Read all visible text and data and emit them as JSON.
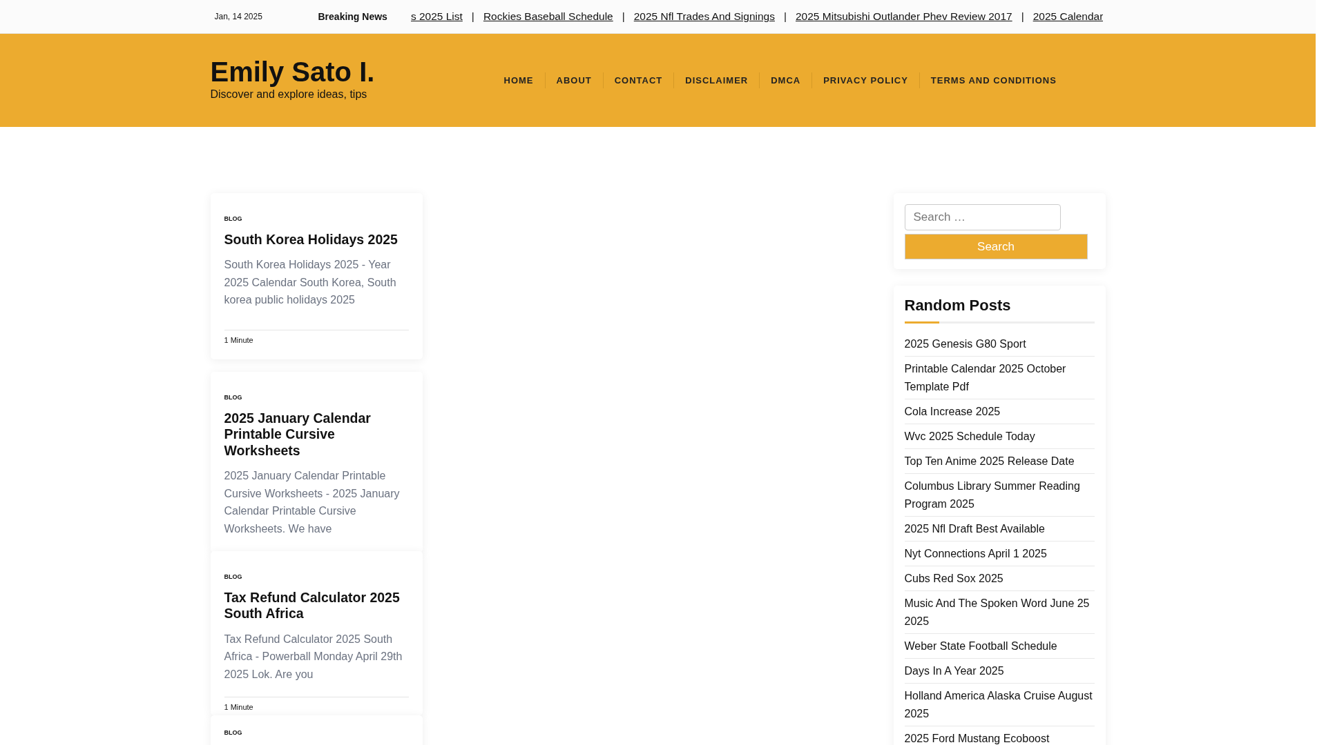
{
  "topbar": {
    "date": "Jan, 14 2025",
    "breaking_label": "Breaking News",
    "separator": "|",
    "ticker": [
      "s 2025 List",
      "Rockies Baseball Schedule",
      "2025 Nfl Trades And Signings",
      "2025 Mitsubishi Outlander Phev Review 2017",
      "2025 Calendar"
    ]
  },
  "header": {
    "site_title": "Emily Sato I.",
    "tagline": "Discover and explore ideas, tips"
  },
  "nav": [
    "HOME",
    "ABOUT",
    "CONTACT",
    "DISCLAIMER",
    "DMCA",
    "PRIVACY POLICY",
    "TERMS AND CONDITIONS"
  ],
  "posts": [
    {
      "category": "BLOG",
      "title": "South Korea Holidays 2025",
      "excerpt": "South Korea Holidays 2025 - Year 2025 Calendar South Korea, South korea public holidays 2025",
      "read_time": "1 Minute"
    },
    {
      "category": "BLOG",
      "title": "2025 January Calendar Printable Cursive Worksheets",
      "excerpt": "2025 January Calendar Printable Cursive Worksheets - 2025 January Calendar Printable Cursive Worksheets. We have"
    },
    {
      "category": "BLOG",
      "title": "Tax Refund Calculator 2025 South Africa",
      "excerpt": "Tax Refund Calculator 2025 South Africa - Powerball Monday April 29th 2025 Lok. Are you",
      "read_time": "1 Minute"
    },
    {
      "category": "BLOG"
    }
  ],
  "search": {
    "placeholder": "Search …",
    "button": "Search"
  },
  "random_posts": {
    "title": "Random Posts",
    "items": [
      "2025 Genesis G80 Sport",
      "Printable Calendar 2025 October Template Pdf",
      "Cola Increase 2025",
      "Wvc 2025 Schedule Today",
      "Top Ten Anime 2025 Release Date",
      "Columbus Library Summer Reading Program 2025",
      "2025 Nfl Draft Best Available",
      "Nyt Connections April 1 2025",
      "Cubs Red Sox 2025",
      "Music And The Spoken Word June 25 2025",
      "Weber State Football Schedule",
      "Days In A Year 2025",
      "Holland America Alaska Cruise August 2025",
      "2025 Ford Mustang Ecoboost"
    ]
  }
}
